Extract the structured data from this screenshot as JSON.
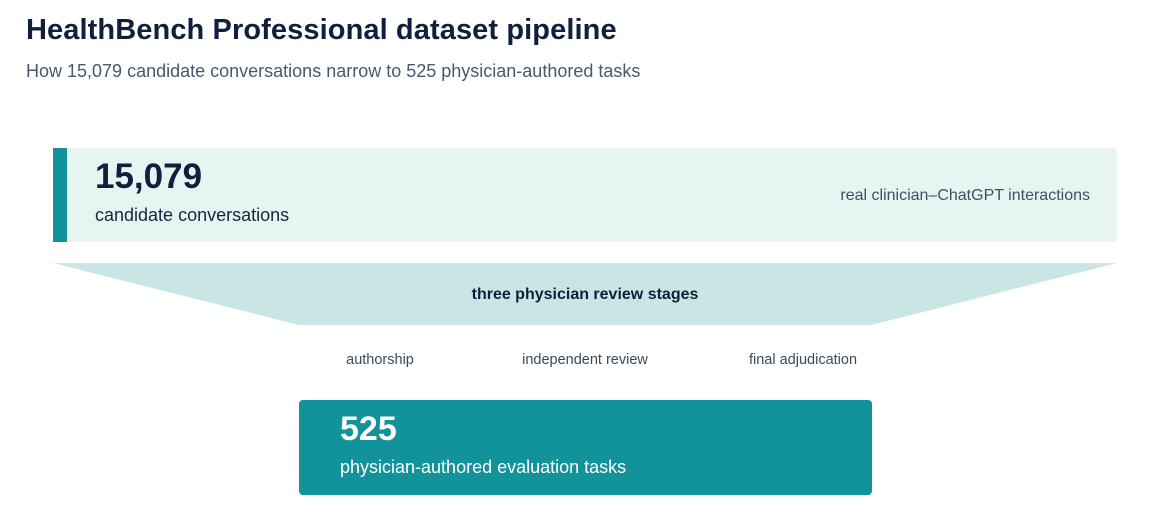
{
  "header": {
    "title": "HealthBench Professional dataset pipeline",
    "subtitle": "How 15,079 candidate conversations narrow to 525 physician-authored tasks"
  },
  "input": {
    "count": "15,079",
    "label": "candidate conversations",
    "note": "real clinician–ChatGPT interactions"
  },
  "filter": {
    "label": "three physician review stages",
    "stages": [
      "authorship",
      "independent review",
      "final adjudication"
    ]
  },
  "output": {
    "count": "525",
    "label": "physician-authored evaluation tasks"
  },
  "colors": {
    "accent": "#12929a",
    "input_fill": "#e6f4f2",
    "funnel_fill": "#c9e6e5",
    "text_dark": "#0f1f3d"
  }
}
